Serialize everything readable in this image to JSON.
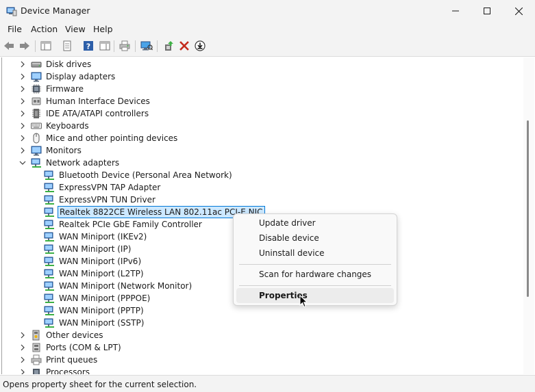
{
  "window": {
    "title": "Device Manager"
  },
  "menu": [
    "File",
    "Action",
    "View",
    "Help"
  ],
  "tree": [
    {
      "label": "Disk drives",
      "level": 0,
      "expander": "collapsed",
      "icon": "disk-drive-icon"
    },
    {
      "label": "Display adapters",
      "level": 0,
      "expander": "collapsed",
      "icon": "monitor-icon"
    },
    {
      "label": "Firmware",
      "level": 0,
      "expander": "collapsed",
      "icon": "chip-icon"
    },
    {
      "label": "Human Interface Devices",
      "level": 0,
      "expander": "collapsed",
      "icon": "hid-icon"
    },
    {
      "label": "IDE ATA/ATAPI controllers",
      "level": 0,
      "expander": "collapsed",
      "icon": "controller-icon"
    },
    {
      "label": "Keyboards",
      "level": 0,
      "expander": "collapsed",
      "icon": "keyboard-icon"
    },
    {
      "label": "Mice and other pointing devices",
      "level": 0,
      "expander": "collapsed",
      "icon": "mouse-icon"
    },
    {
      "label": "Monitors",
      "level": 0,
      "expander": "collapsed",
      "icon": "monitor-icon"
    },
    {
      "label": "Network adapters",
      "level": 0,
      "expander": "expanded",
      "icon": "network-adapter-icon"
    },
    {
      "label": "Bluetooth Device (Personal Area Network)",
      "level": 1,
      "icon": "network-adapter-icon"
    },
    {
      "label": "ExpressVPN TAP Adapter",
      "level": 1,
      "icon": "network-adapter-icon"
    },
    {
      "label": "ExpressVPN TUN Driver",
      "level": 1,
      "icon": "network-adapter-icon"
    },
    {
      "label": "Realtek 8822CE Wireless LAN 802.11ac PCI-E NIC",
      "level": 1,
      "icon": "network-adapter-icon",
      "selected": true
    },
    {
      "label": "Realtek PCIe GbE Family Controller",
      "level": 1,
      "icon": "network-adapter-icon"
    },
    {
      "label": "WAN Miniport (IKEv2)",
      "level": 1,
      "icon": "network-adapter-icon"
    },
    {
      "label": "WAN Miniport (IP)",
      "level": 1,
      "icon": "network-adapter-icon"
    },
    {
      "label": "WAN Miniport (IPv6)",
      "level": 1,
      "icon": "network-adapter-icon"
    },
    {
      "label": "WAN Miniport (L2TP)",
      "level": 1,
      "icon": "network-adapter-icon"
    },
    {
      "label": "WAN Miniport (Network Monitor)",
      "level": 1,
      "icon": "network-adapter-icon"
    },
    {
      "label": "WAN Miniport (PPPOE)",
      "level": 1,
      "icon": "network-adapter-icon"
    },
    {
      "label": "WAN Miniport (PPTP)",
      "level": 1,
      "icon": "network-adapter-icon"
    },
    {
      "label": "WAN Miniport (SSTP)",
      "level": 1,
      "icon": "network-adapter-icon"
    },
    {
      "label": "Other devices",
      "level": 0,
      "expander": "collapsed",
      "icon": "unknown-device-icon"
    },
    {
      "label": "Ports (COM & LPT)",
      "level": 0,
      "expander": "collapsed",
      "icon": "port-icon"
    },
    {
      "label": "Print queues",
      "level": 0,
      "expander": "collapsed",
      "icon": "printer-icon"
    },
    {
      "label": "Processors",
      "level": 0,
      "expander": "collapsed",
      "icon": "processor-icon"
    }
  ],
  "context_menu": {
    "items": [
      {
        "label": "Update driver"
      },
      {
        "label": "Disable device"
      },
      {
        "label": "Uninstall device"
      },
      {
        "label": "Scan for hardware changes"
      },
      {
        "label": "Properties",
        "bold": true,
        "hover": true
      }
    ]
  },
  "status": {
    "text": "Opens property sheet for the current selection."
  },
  "colors": {
    "selection_bg": "#cce8ff",
    "selection_border": "#0078d7",
    "delete_red": "#c42b1c"
  }
}
